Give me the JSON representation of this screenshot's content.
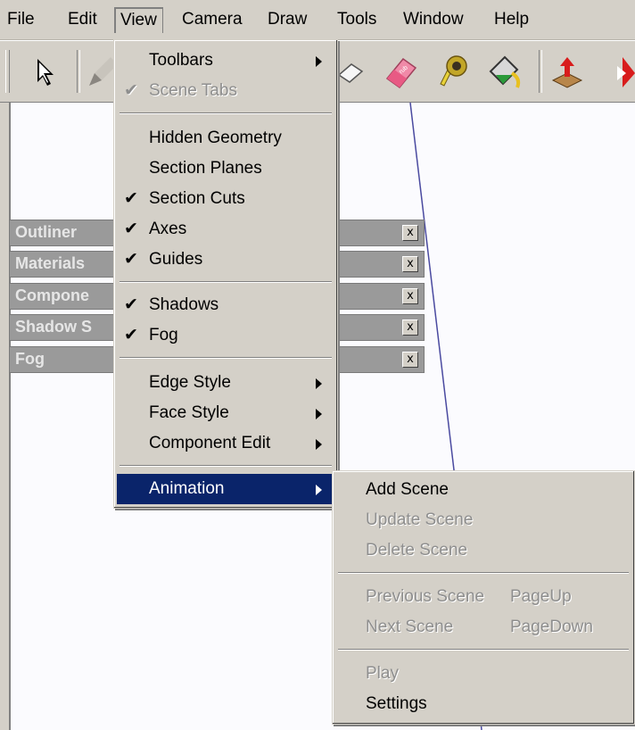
{
  "menubar": {
    "items": [
      "File",
      "Edit",
      "View",
      "Camera",
      "Draw",
      "Tools",
      "Window",
      "Help"
    ],
    "open": "View"
  },
  "toolbar": {
    "tools": [
      "select-arrow-icon",
      "pencil-icon",
      "push-pull-icon",
      "eraser-icon",
      "tape-measure-icon",
      "paint-bucket-icon",
      "orbit-icon",
      "move-icon",
      "rotate-icon"
    ]
  },
  "dialogs": [
    {
      "title": "Outliner",
      "close": "x"
    },
    {
      "title": "Materials",
      "close": "x"
    },
    {
      "title": "Compone",
      "close": "x"
    },
    {
      "title": "Shadow S",
      "close": "x"
    },
    {
      "title": "Fog",
      "close": "x"
    }
  ],
  "view_menu": {
    "items": [
      {
        "label": "Toolbars",
        "checked": false,
        "disabled": false,
        "submenu": true
      },
      {
        "label": "Scene Tabs",
        "checked": true,
        "disabled": true,
        "submenu": false
      },
      {
        "label": "Hidden Geometry",
        "checked": false,
        "disabled": false,
        "submenu": false
      },
      {
        "label": "Section Planes",
        "checked": false,
        "disabled": false,
        "submenu": false
      },
      {
        "label": "Section Cuts",
        "checked": true,
        "disabled": false,
        "submenu": false
      },
      {
        "label": "Axes",
        "checked": true,
        "disabled": false,
        "submenu": false
      },
      {
        "label": "Guides",
        "checked": true,
        "disabled": false,
        "submenu": false
      },
      {
        "label": "Shadows",
        "checked": true,
        "disabled": false,
        "submenu": false
      },
      {
        "label": "Fog",
        "checked": true,
        "disabled": false,
        "submenu": false
      },
      {
        "label": "Edge Style",
        "checked": false,
        "disabled": false,
        "submenu": true
      },
      {
        "label": "Face Style",
        "checked": false,
        "disabled": false,
        "submenu": true
      },
      {
        "label": "Component Edit",
        "checked": false,
        "disabled": false,
        "submenu": true
      },
      {
        "label": "Animation",
        "checked": false,
        "disabled": false,
        "submenu": true,
        "highlighted": true
      }
    ],
    "check_glyph": "✔"
  },
  "animation_submenu": {
    "items": [
      {
        "label": "Add Scene",
        "shortcut": "",
        "disabled": false
      },
      {
        "label": "Update Scene",
        "shortcut": "",
        "disabled": true
      },
      {
        "label": "Delete Scene",
        "shortcut": "",
        "disabled": true
      },
      {
        "label": "Previous Scene",
        "shortcut": "PageUp",
        "disabled": true
      },
      {
        "label": "Next Scene",
        "shortcut": "PageDown",
        "disabled": true
      },
      {
        "label": "Play",
        "shortcut": "",
        "disabled": true
      },
      {
        "label": "Settings",
        "shortcut": "",
        "disabled": false
      }
    ]
  },
  "colors": {
    "highlight": "#0a246a",
    "face": "#d4d0c8",
    "canvas": "#fbfbfe",
    "dialog_strip": "#9a9a9a"
  }
}
